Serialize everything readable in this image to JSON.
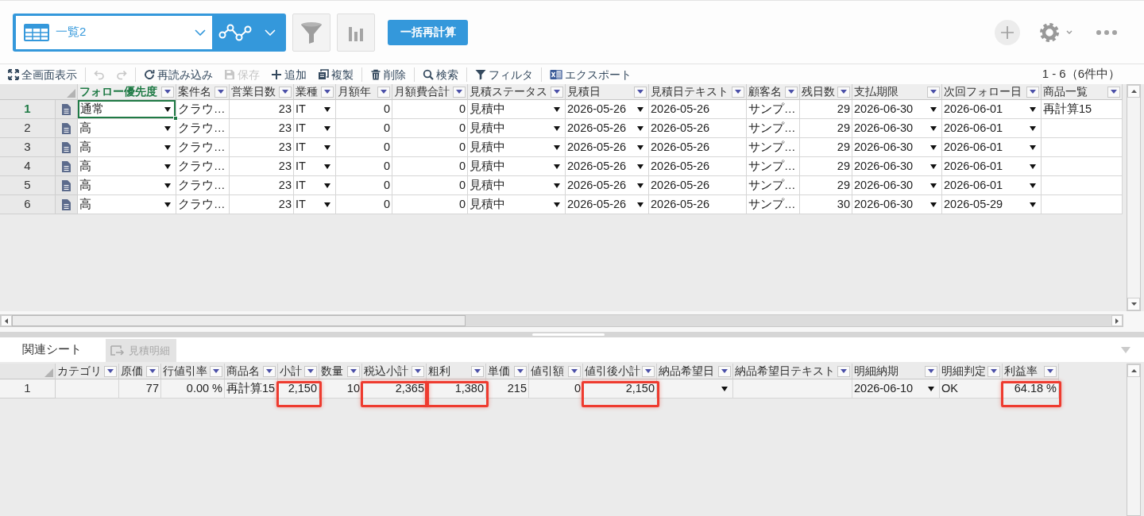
{
  "view_switcher": {
    "view_name": "一覧2"
  },
  "recalculate_button": {
    "label": "一括再計算"
  },
  "toolbar": {
    "groups": [
      [
        {
          "kind": "fullscreen",
          "label": "全画面表示",
          "disabled": false
        }
      ],
      [
        {
          "kind": "undo",
          "disabled": true
        },
        {
          "kind": "redo",
          "disabled": true
        }
      ],
      [
        {
          "kind": "reload",
          "label": "再読み込み",
          "disabled": false
        },
        {
          "kind": "save",
          "label": "保存",
          "disabled": true
        },
        {
          "kind": "add",
          "label": "追加",
          "disabled": false
        },
        {
          "kind": "duplicate",
          "label": "複製",
          "disabled": false
        }
      ],
      [
        {
          "kind": "delete",
          "label": "削除",
          "disabled": false
        }
      ],
      [
        {
          "kind": "search",
          "label": "検索",
          "disabled": false
        }
      ],
      [
        {
          "kind": "filter",
          "label": "フィルタ",
          "disabled": false
        }
      ],
      [
        {
          "kind": "export",
          "label": "エクスポート",
          "disabled": false
        }
      ]
    ],
    "record_count": "1 - 6（6件中）"
  },
  "main_grid": {
    "columns": [
      {
        "label": "フォロー優先度",
        "kind": "dropdown",
        "selected": true
      },
      {
        "label": "案件名",
        "kind": "text",
        "selected": false
      },
      {
        "label": "営業日数",
        "kind": "number",
        "selected": false
      },
      {
        "label": "業種",
        "kind": "dropdown",
        "selected": false
      },
      {
        "label": "月額年",
        "kind": "number",
        "selected": false
      },
      {
        "label": "月額費合計",
        "kind": "number",
        "selected": false
      },
      {
        "label": "見積ステータス",
        "kind": "dropdown",
        "selected": false
      },
      {
        "label": "見積日",
        "kind": "dropdown",
        "selected": false
      },
      {
        "label": "見積日テキスト",
        "kind": "text",
        "selected": false
      },
      {
        "label": "顧客名",
        "kind": "text",
        "selected": false
      },
      {
        "label": "残日数",
        "kind": "number",
        "selected": false
      },
      {
        "label": "支払期限",
        "kind": "dropdown",
        "selected": false
      },
      {
        "label": "次回フォロー日",
        "kind": "dropdown",
        "selected": false
      },
      {
        "label": "商品一覧",
        "kind": "text",
        "selected": false
      }
    ],
    "rows": [
      {
        "number": "1",
        "selected": true,
        "cells": [
          "通常",
          "クラウ…",
          "23",
          "IT",
          "0",
          "0",
          "見積中",
          "2026-05-26",
          "2026-05-26",
          "サンプ…",
          "29",
          "2026-06-30",
          "2026-06-01",
          "再計算15"
        ]
      },
      {
        "number": "2",
        "selected": false,
        "cells": [
          "高",
          "クラウ…",
          "23",
          "IT",
          "0",
          "0",
          "見積中",
          "2026-05-26",
          "2026-05-26",
          "サンプ…",
          "29",
          "2026-06-30",
          "2026-06-01"
        ]
      },
      {
        "number": "3",
        "selected": false,
        "cells": [
          "高",
          "クラウ…",
          "23",
          "IT",
          "0",
          "0",
          "見積中",
          "2026-05-26",
          "2026-05-26",
          "サンプ…",
          "29",
          "2026-06-30",
          "2026-06-01"
        ]
      },
      {
        "number": "4",
        "selected": false,
        "cells": [
          "高",
          "クラウ…",
          "23",
          "IT",
          "0",
          "0",
          "見積中",
          "2026-05-26",
          "2026-05-26",
          "サンプ…",
          "29",
          "2026-06-30",
          "2026-06-01"
        ]
      },
      {
        "number": "5",
        "selected": false,
        "cells": [
          "高",
          "クラウ…",
          "23",
          "IT",
          "0",
          "0",
          "見積中",
          "2026-05-26",
          "2026-05-26",
          "サンプ…",
          "29",
          "2026-06-30",
          "2026-06-01"
        ]
      },
      {
        "number": "6",
        "selected": false,
        "cells": [
          "高",
          "クラウ…",
          "23",
          "IT",
          "0",
          "0",
          "見積中",
          "2026-05-26",
          "2026-05-26",
          "サンプ…",
          "30",
          "2026-06-30",
          "2026-05-29"
        ]
      }
    ]
  },
  "related_sheets": {
    "title": "関連シート",
    "tabs": [
      {
        "label": "見積明細",
        "selected": true
      }
    ]
  },
  "detail_grid": {
    "columns": [
      {
        "label": "カテゴリ",
        "kind": "text"
      },
      {
        "label": "原価",
        "kind": "number"
      },
      {
        "label": "行値引率",
        "kind": "number"
      },
      {
        "label": "商品名",
        "kind": "text"
      },
      {
        "label": "小計",
        "kind": "number"
      },
      {
        "label": "数量",
        "kind": "number"
      },
      {
        "label": "税込小計",
        "kind": "number"
      },
      {
        "label": "粗利",
        "kind": "number"
      },
      {
        "label": "単価",
        "kind": "number"
      },
      {
        "label": "値引額",
        "kind": "number"
      },
      {
        "label": "値引後小計",
        "kind": "number"
      },
      {
        "label": "納品希望日",
        "kind": "dropdown"
      },
      {
        "label": "納品希望日テキスト",
        "kind": "text"
      },
      {
        "label": "明細納期",
        "kind": "dropdown"
      },
      {
        "label": "明細判定",
        "kind": "text"
      },
      {
        "label": "利益率",
        "kind": "number"
      }
    ],
    "rows": [
      {
        "number": "1",
        "cells": [
          {
            "highlighted": false
          },
          {
            "value": "77",
            "highlighted": false
          },
          {
            "value": "0.00 %",
            "highlighted": false
          },
          {
            "value": "再計算15",
            "highlighted": false
          },
          {
            "value": "2,150",
            "highlighted": true
          },
          {
            "value": "10",
            "highlighted": false
          },
          {
            "value": "2,365",
            "highlighted": true
          },
          {
            "value": "1,380",
            "highlighted": true
          },
          {
            "value": "215",
            "highlighted": false
          },
          {
            "value": "0",
            "highlighted": false
          },
          {
            "value": "2,150",
            "highlighted": true
          },
          {
            "highlighted": false
          },
          {
            "highlighted": false
          },
          {
            "value": "2026-06-10",
            "highlighted": false
          },
          {
            "value": "OK",
            "highlighted": false
          },
          {
            "value": "64.18 %",
            "highlighted": true
          }
        ]
      }
    ]
  }
}
